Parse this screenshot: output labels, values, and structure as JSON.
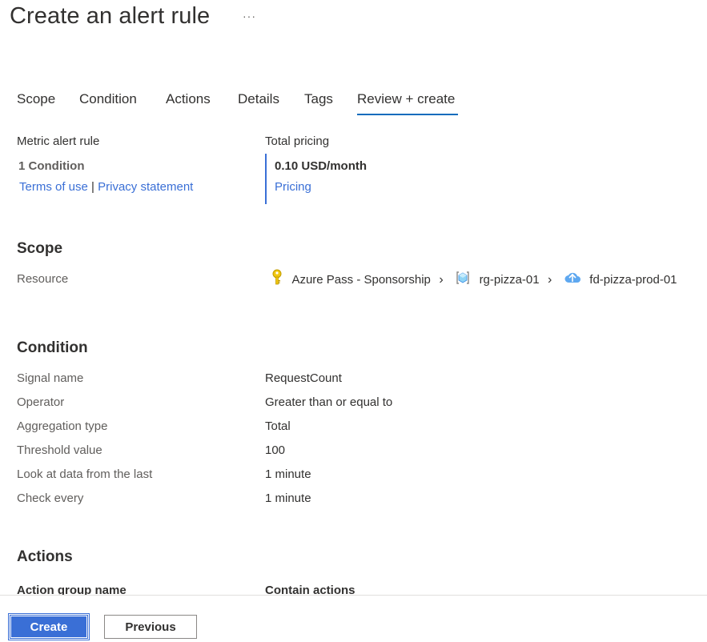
{
  "page": {
    "title": "Create an alert rule",
    "more": "···"
  },
  "tabs": [
    "Scope",
    "Condition",
    "Actions",
    "Details",
    "Tags",
    "Review + create"
  ],
  "summary": {
    "rule_type": "Metric alert rule",
    "condition_count": "1 Condition",
    "terms": "Terms of use",
    "separator": "|",
    "privacy": "Privacy statement",
    "pricing_label": "Total pricing",
    "pricing_value": "0.10 USD/month",
    "pricing_link": "Pricing"
  },
  "scope": {
    "heading": "Scope",
    "resource_label": "Resource",
    "breadcrumbs": [
      {
        "label": "Azure Pass - Sponsorship",
        "icon": "key-icon"
      },
      {
        "label": "rg-pizza-01",
        "icon": "resource-group-icon"
      },
      {
        "label": "fd-pizza-prod-01",
        "icon": "front-door-icon"
      }
    ]
  },
  "condition": {
    "heading": "Condition",
    "rows": [
      {
        "label": "Signal name",
        "value": "RequestCount"
      },
      {
        "label": "Operator",
        "value": "Greater than or equal to"
      },
      {
        "label": "Aggregation type",
        "value": "Total"
      },
      {
        "label": "Threshold value",
        "value": "100"
      },
      {
        "label": "Look at data from the last",
        "value": "1 minute"
      },
      {
        "label": "Check every",
        "value": "1 minute"
      }
    ]
  },
  "actions": {
    "heading": "Actions",
    "columns": [
      "Action group name",
      "Contain actions"
    ]
  },
  "footer": {
    "create": "Create",
    "previous": "Previous"
  },
  "colors": {
    "accent": "#3a6fd6",
    "key": "#f2c811",
    "cloud": "#3a8ee6"
  }
}
